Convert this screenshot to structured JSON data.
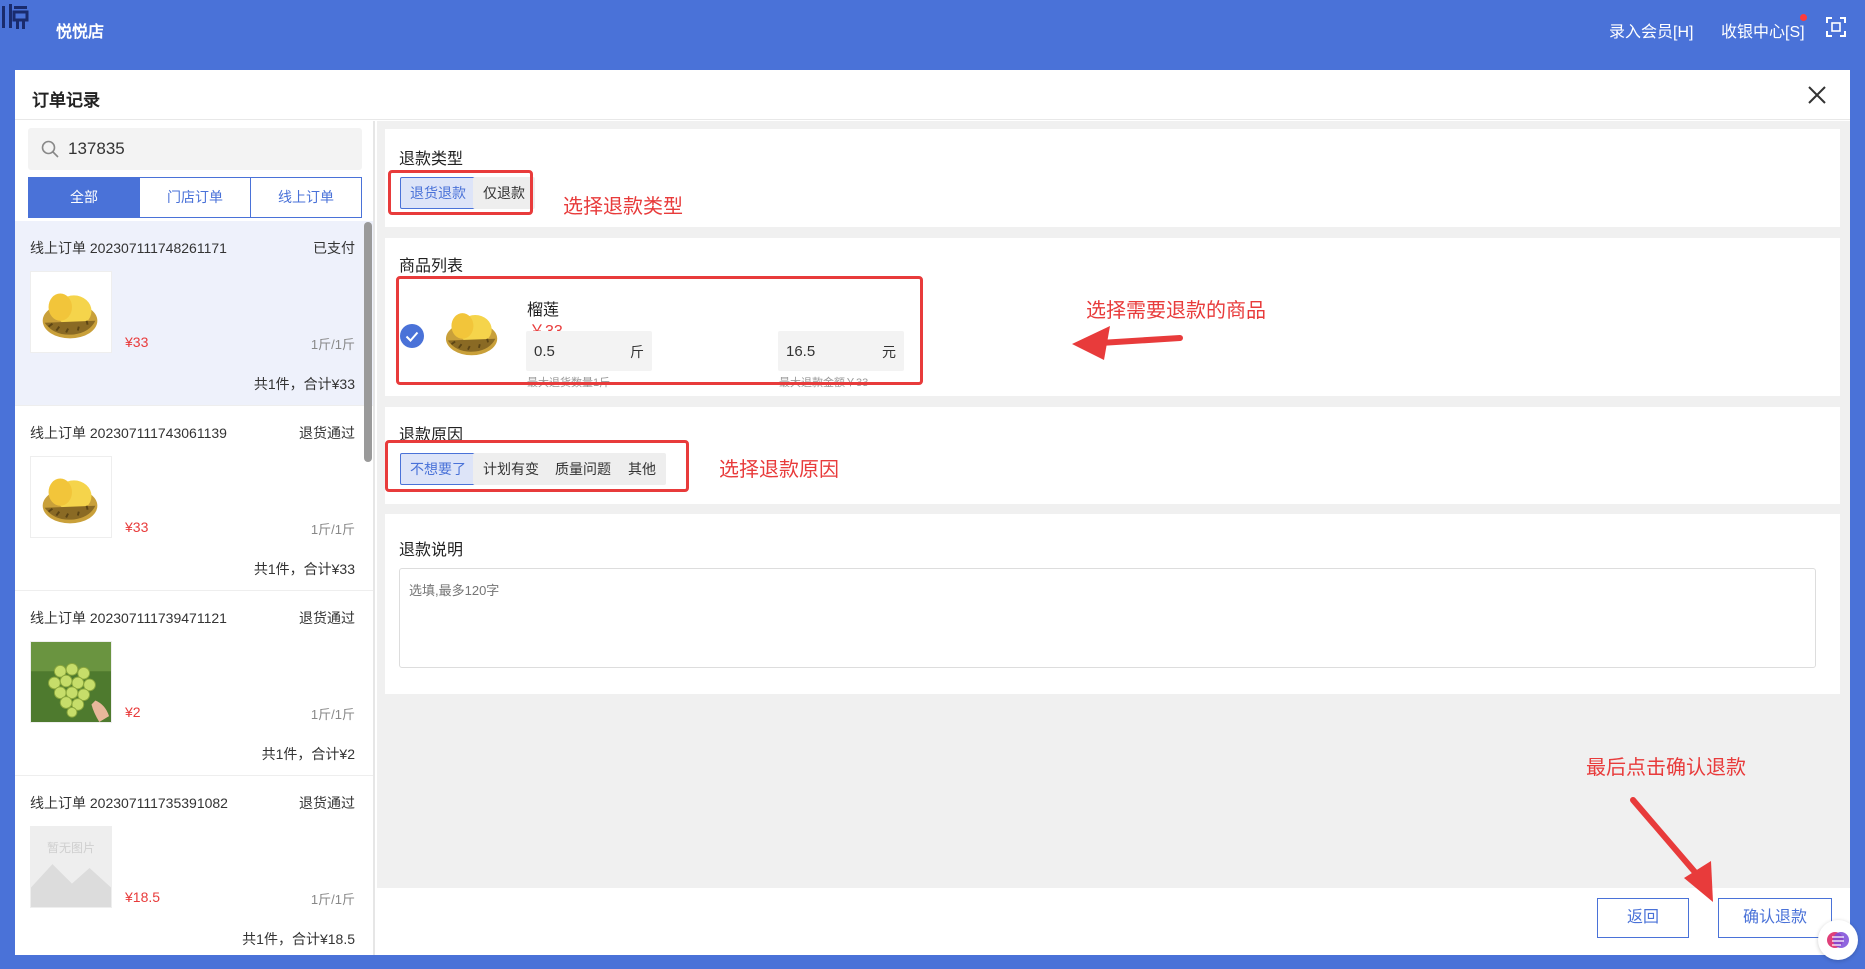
{
  "app": {
    "name": "悦悦店"
  },
  "header": {
    "member_label": "录入会员[H]",
    "cashier_label": "收银中心[S]"
  },
  "modal": {
    "title": "订单记录"
  },
  "search": {
    "value": "137835"
  },
  "tabs": [
    {
      "label": "全部",
      "active": true
    },
    {
      "label": "门店订单",
      "active": false
    },
    {
      "label": "线上订单",
      "active": false
    }
  ],
  "orders": [
    {
      "title": "线上订单 202307111748261171",
      "status": "已支付",
      "price": "¥33",
      "unit": "1斤/1斤",
      "total": "共1件，合计¥33",
      "image": "durian-icon"
    },
    {
      "title": "线上订单 202307111743061139",
      "status": "退货通过",
      "price": "¥33",
      "unit": "1斤/1斤",
      "total": "共1件，合计¥33",
      "image": "durian-icon"
    },
    {
      "title": "线上订单 202307111739471121",
      "status": "退货通过",
      "price": "¥2",
      "unit": "1斤/1斤",
      "total": "共1件，合计¥2",
      "image": "grapes-icon"
    },
    {
      "title": "线上订单 202307111735391082",
      "status": "退货通过",
      "price": "¥18.5",
      "unit": "1斤/1斤",
      "total": "共1件，合计¥18.5",
      "image": "placeholder-image-icon",
      "placeholder_text": "暂无图片"
    }
  ],
  "refund_type": {
    "title": "退款类型",
    "options": [
      {
        "label": "退货退款",
        "active": true
      },
      {
        "label": "仅退款",
        "active": false
      }
    ],
    "annotation": "选择退款类型"
  },
  "product_list": {
    "title": "商品列表",
    "product": {
      "name": "榴莲",
      "price": "￥33",
      "qty_value": "0.5",
      "qty_unit": "斤",
      "qty_hint": "最大退货数量1斤",
      "amount_value": "16.5",
      "amount_unit": "元",
      "amount_hint": "最大退款金额￥33",
      "checked": true
    },
    "annotation": "选择需要退款的商品"
  },
  "refund_reason": {
    "title": "退款原因",
    "options": [
      {
        "label": "不想要了",
        "active": true
      },
      {
        "label": "计划有变",
        "active": false
      },
      {
        "label": "质量问题",
        "active": false
      },
      {
        "label": "其他",
        "active": false
      }
    ],
    "annotation": "选择退款原因"
  },
  "refund_note": {
    "title": "退款说明",
    "placeholder": "选填,最多120字"
  },
  "footer": {
    "back_label": "返回",
    "confirm_label": "确认退款",
    "annotation": "最后点击确认退款"
  },
  "colors": {
    "accent": "#4a72d8",
    "annotation": "#e83b3b",
    "price": "#e83b3b"
  }
}
